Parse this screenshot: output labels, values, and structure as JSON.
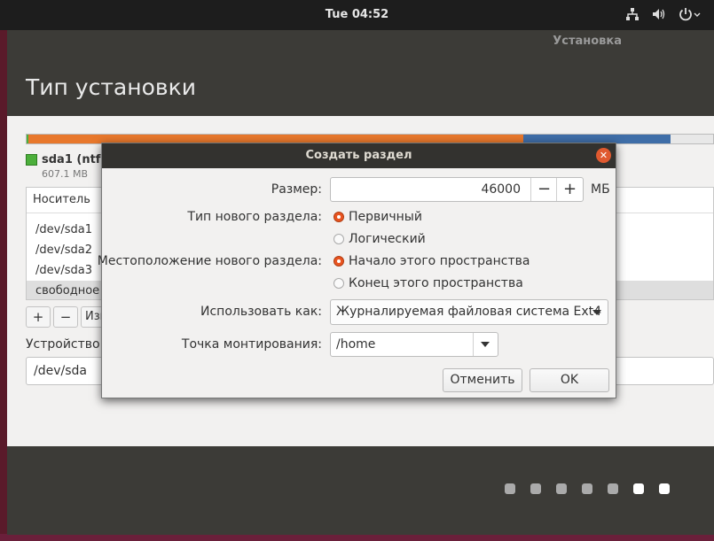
{
  "top_bar": {
    "clock": "Tue 04:52",
    "tray_icons": [
      "network-icon",
      "volume-icon",
      "power-icon"
    ]
  },
  "installer": {
    "window_title": "Установка",
    "page_title": "Тип установки"
  },
  "partition_bar": {
    "segments": [
      {
        "color": "#4caf3b",
        "fraction": 0.003
      },
      {
        "color": "#e8782c",
        "fraction": 0.72
      },
      {
        "color": "#3f6ea8",
        "fraction": 0.215
      },
      {
        "color": "#e8e8e8",
        "fraction": 0.062
      }
    ]
  },
  "legend": {
    "name": "sda1 (ntfs)",
    "size": "607.1 MB",
    "color": "#4caf3b"
  },
  "partition_table": {
    "header": "Носитель",
    "rows": [
      "/dev/sda1",
      "/dev/sda2",
      "/dev/sda3",
      "свободное место"
    ],
    "selected_row": 3
  },
  "table_buttons": {
    "add": "+",
    "remove": "−",
    "change": "Изменить..."
  },
  "boot_device": {
    "label": "Устройство для установки системного загрузчика:",
    "value": "/dev/sda"
  },
  "dialog": {
    "title": "Создать раздел",
    "size_label": "Размер:",
    "size_value": "46000",
    "size_unit": "МБ",
    "minus": "−",
    "plus": "+",
    "type_label": "Тип нового раздела:",
    "type_primary": "Первичный",
    "type_logical": "Логический",
    "type_selected": "primary",
    "location_label": "Местоположение нового раздела:",
    "location_begin": "Начало этого пространства",
    "location_end": "Конец этого пространства",
    "location_selected": "begin",
    "use_as_label": "Использовать как:",
    "use_as_value": "Журналируемая файловая система Ext4",
    "mount_label": "Точка монтирования:",
    "mount_value": "/home",
    "cancel": "Отменить",
    "ok": "OK",
    "accent_color": "#e95420"
  },
  "progress_dots": {
    "total": 7,
    "active": [
      5,
      6
    ]
  }
}
